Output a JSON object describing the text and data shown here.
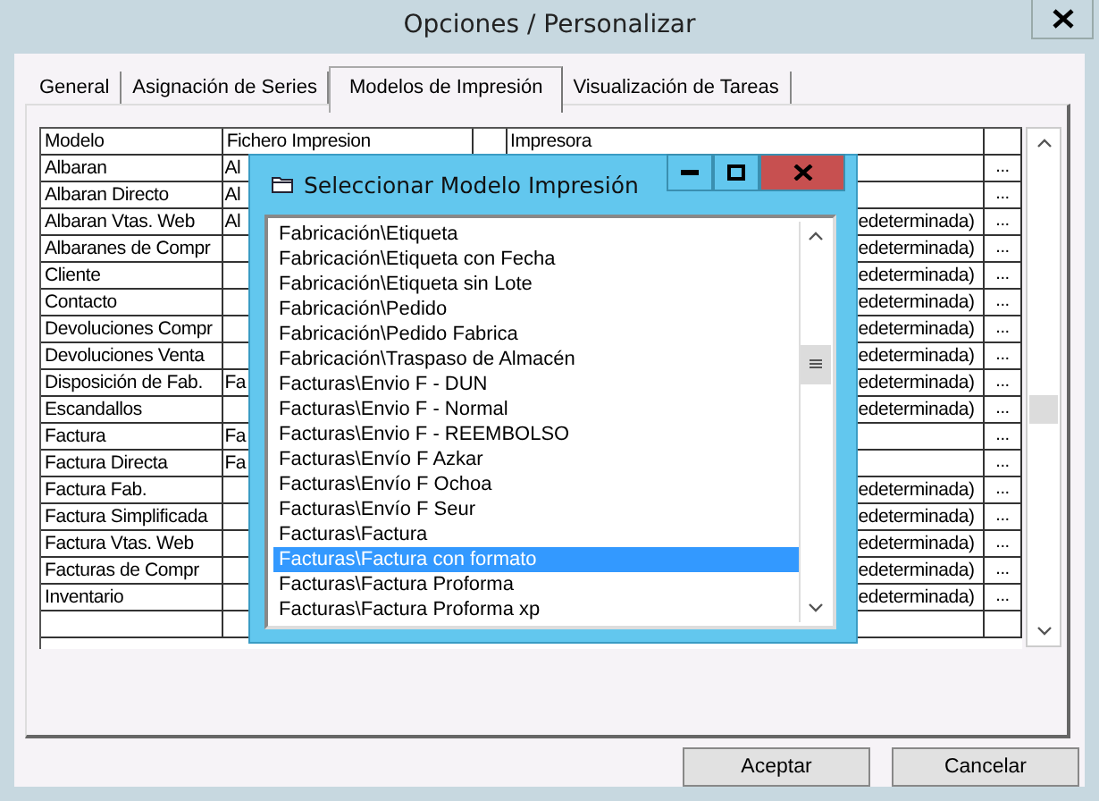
{
  "window": {
    "title": "Opciones / Personalizar"
  },
  "tabs": [
    {
      "label": "General",
      "selected": false
    },
    {
      "label": "Asignación de Series",
      "selected": false
    },
    {
      "label": "Modelos de Impresión",
      "selected": true
    },
    {
      "label": "Visualización de Tareas",
      "selected": false
    }
  ],
  "table": {
    "columns": [
      "Modelo",
      "Fichero Impresion",
      "Impresora"
    ],
    "rows": [
      {
        "modelo": "Albaran",
        "fichero": "Al",
        "button": "..."
      },
      {
        "modelo": "Albaran Directo",
        "fichero": "Al",
        "button": "..."
      },
      {
        "modelo": "Albaran Vtas. Web",
        "fichero": "Al",
        "impresora": "edeterminada)",
        "button": "..."
      },
      {
        "modelo": "Albaranes de Compr",
        "impresora": "edeterminada)",
        "button": "..."
      },
      {
        "modelo": "Cliente",
        "impresora": "edeterminada)",
        "button": "..."
      },
      {
        "modelo": "Contacto",
        "impresora": "edeterminada)",
        "button": "..."
      },
      {
        "modelo": "Devoluciones Compr",
        "impresora": "edeterminada)",
        "button": "..."
      },
      {
        "modelo": "Devoluciones Venta",
        "impresora": "edeterminada)",
        "button": "..."
      },
      {
        "modelo": "Disposición de Fab.",
        "fichero": "Fa",
        "impresora": "edeterminada)",
        "button": "..."
      },
      {
        "modelo": "Escandallos",
        "impresora": "edeterminada)",
        "button": "..."
      },
      {
        "modelo": "Factura",
        "fichero": "Fa",
        "button": "..."
      },
      {
        "modelo": "Factura Directa",
        "fichero": "Fa",
        "button": "..."
      },
      {
        "modelo": "Factura Fab.",
        "impresora": "edeterminada)",
        "button": "..."
      },
      {
        "modelo": "Factura Simplificada",
        "impresora": "edeterminada)",
        "button": "..."
      },
      {
        "modelo": "Factura Vtas. Web",
        "impresora": "edeterminada)",
        "button": "..."
      },
      {
        "modelo": "Facturas de Compr",
        "impresora": "edeterminada)",
        "button": "..."
      },
      {
        "modelo": "Inventario",
        "impresora": "edeterminada)",
        "button": "..."
      }
    ]
  },
  "dialog": {
    "title": "Seleccionar Modelo Impresión",
    "items": [
      {
        "label": "Fabricación\\Etiqueta",
        "selected": false
      },
      {
        "label": "Fabricación\\Etiqueta con Fecha",
        "selected": false
      },
      {
        "label": "Fabricación\\Etiqueta sin Lote",
        "selected": false
      },
      {
        "label": "Fabricación\\Pedido",
        "selected": false
      },
      {
        "label": "Fabricación\\Pedido Fabrica",
        "selected": false
      },
      {
        "label": "Fabricación\\Traspaso de Almacén",
        "selected": false
      },
      {
        "label": "Facturas\\Envio F - DUN",
        "selected": false
      },
      {
        "label": "Facturas\\Envio F - Normal",
        "selected": false
      },
      {
        "label": "Facturas\\Envio F - REEMBOLSO",
        "selected": false
      },
      {
        "label": "Facturas\\Envío F Azkar",
        "selected": false
      },
      {
        "label": "Facturas\\Envío F Ochoa",
        "selected": false
      },
      {
        "label": "Facturas\\Envío F Seur",
        "selected": false
      },
      {
        "label": "Facturas\\Factura",
        "selected": false
      },
      {
        "label": "Facturas\\Factura con formato",
        "selected": true
      },
      {
        "label": "Facturas\\Factura Proforma",
        "selected": false
      },
      {
        "label": "Facturas\\Factura Proforma xp",
        "selected": false
      }
    ]
  },
  "buttons": [
    "Aceptar",
    "Cancelar"
  ]
}
